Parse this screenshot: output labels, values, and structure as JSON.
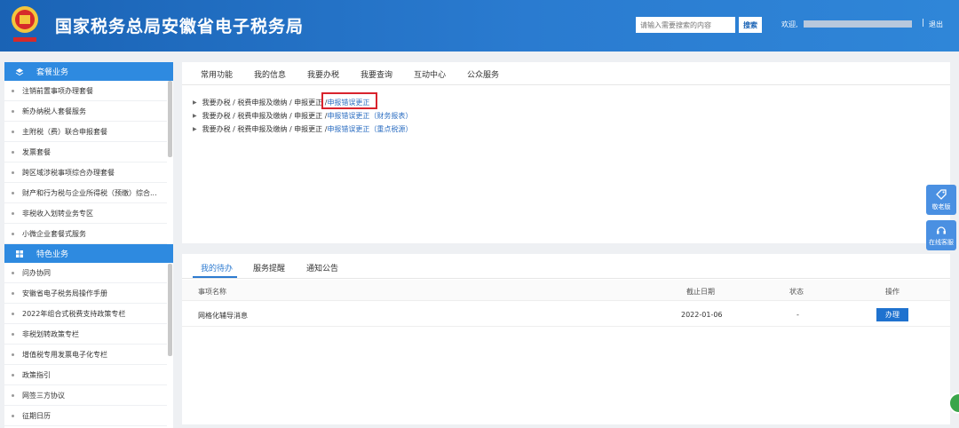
{
  "header": {
    "title": "国家税务总局安徽省电子税务局",
    "search_placeholder": "请输入需要搜索的内容",
    "search_button": "搜索",
    "welcome": "欢迎,",
    "logout": "退出",
    "brand_color": "#1a63b5"
  },
  "sidebar": {
    "sections": [
      {
        "title": "套餐业务",
        "icon": "layers-icon",
        "items": [
          "注销前置事项办理套餐",
          "新办纳税人套餐服务",
          "主附税（费）联合申报套餐",
          "发票套餐",
          "跨区域涉税事项综合办理套餐",
          "财产和行为税与企业所得税（预缴）综合...",
          "非税收入划转业务专区",
          "小微企业套餐式服务"
        ]
      },
      {
        "title": "特色业务",
        "icon": "grid-icon",
        "items": [
          "问办协同",
          "安徽省电子税务局操作手册",
          "2022年组合式税费支持政策专栏",
          "非税划转政策专栏",
          "增值税专用发票电子化专栏",
          "政策指引",
          "网签三方协议",
          "征期日历"
        ]
      }
    ]
  },
  "main": {
    "tabs": [
      "常用功能",
      "我的信息",
      "我要办税",
      "我要查询",
      "互动中心",
      "公众服务"
    ],
    "crumbs": [
      {
        "path": "我要办税 / 税费申报及缴纳 / 申报更正 / ",
        "link": "申报错误更正"
      },
      {
        "path": "我要办税 / 税费申报及缴纳 / 申报更正 / ",
        "link": "申报错误更正（财务报表）"
      },
      {
        "path": "我要办税 / 税费申报及缴纳 / 申报更正 / ",
        "link": "申报错误更正（重点税源）"
      }
    ]
  },
  "todo": {
    "tabs": [
      "我的待办",
      "服务提醒",
      "通知公告"
    ],
    "columns": [
      "事项名称",
      "截止日期",
      "状态",
      "操作"
    ],
    "rows": [
      {
        "name": "网格化辅导消息",
        "date": "2022-01-06",
        "status": "-",
        "action": "办理"
      }
    ]
  },
  "float": {
    "elder": "敬老版",
    "service": "在线客服"
  }
}
